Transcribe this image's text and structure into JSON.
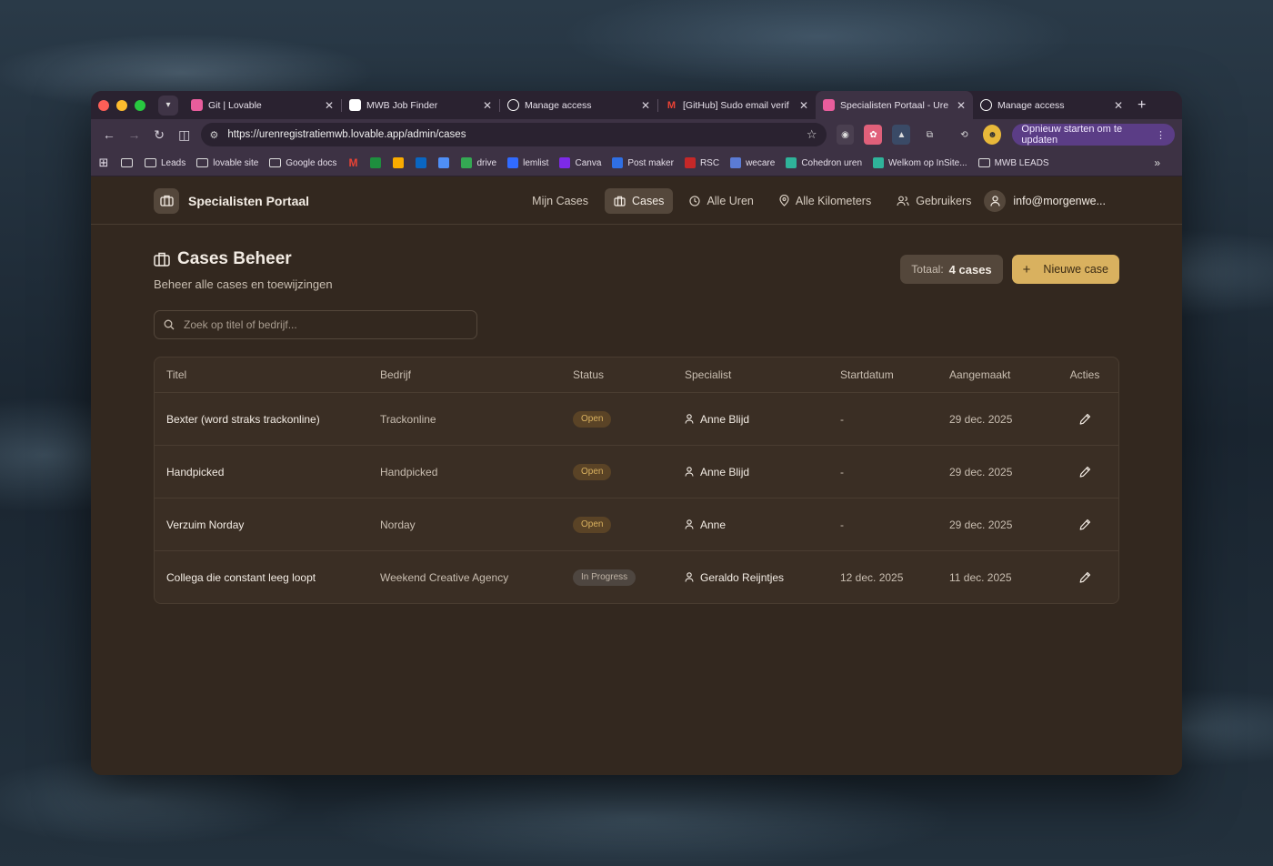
{
  "browser": {
    "tabs": [
      {
        "title": "Git | Lovable",
        "favicon": "lovable-icon",
        "color": "#e85d9c",
        "active": false
      },
      {
        "title": "MWB Job Finder",
        "favicon": "mwb-icon",
        "color": "#ffffff",
        "active": false
      },
      {
        "title": "Manage access",
        "favicon": "github-icon",
        "color": "#ffffff",
        "active": false
      },
      {
        "title": "[GitHub] Sudo email verif",
        "favicon": "gmail-icon",
        "color": "#ea4335",
        "active": false
      },
      {
        "title": "Specialisten Portaal - Ure",
        "favicon": "lovable-icon",
        "color": "#e85d9c",
        "active": true
      },
      {
        "title": "Manage access",
        "favicon": "github-icon",
        "color": "#ffffff",
        "active": false
      }
    ],
    "url": "https://urenregistratiemwb.lovable.app/admin/cases",
    "update_button": "Opnieuw starten om te updaten",
    "bookmarks": [
      {
        "label": "",
        "icon": "apps-icon"
      },
      {
        "label": "",
        "icon": "folder-icon"
      },
      {
        "label": "Leads",
        "icon": "folder-icon"
      },
      {
        "label": "lovable site",
        "icon": "folder-icon"
      },
      {
        "label": "Google docs",
        "icon": "folder-icon"
      },
      {
        "label": "",
        "icon": "gmail-icon",
        "color": "#ea4335"
      },
      {
        "label": "",
        "icon": "meet-icon",
        "color": "#1e8e3e"
      },
      {
        "label": "",
        "icon": "video-icon",
        "color": "#f9ab00"
      },
      {
        "label": "",
        "icon": "linkedin-icon",
        "color": "#0a66c2"
      },
      {
        "label": "",
        "icon": "mail-icon",
        "color": "#4f8ff7"
      },
      {
        "label": "drive",
        "icon": "drive-icon",
        "color": "#34a853"
      },
      {
        "label": "lemlist",
        "icon": "lemlist-icon",
        "color": "#316bff"
      },
      {
        "label": "Canva",
        "icon": "canva-icon",
        "color": "#7d2ae8"
      },
      {
        "label": "Post maker",
        "icon": "postmaker-icon",
        "color": "#2f6fe4"
      },
      {
        "label": "RSC",
        "icon": "rsc-icon",
        "color": "#c62828"
      },
      {
        "label": "wecare",
        "icon": "wecare-icon",
        "color": "#5b7bd5"
      },
      {
        "label": "Cohedron uren",
        "icon": "cohedron-icon",
        "color": "#2fb39a"
      },
      {
        "label": "Welkom op InSite...",
        "icon": "insite-icon",
        "color": "#2fb39a"
      },
      {
        "label": "MWB LEADS",
        "icon": "folder-icon"
      }
    ]
  },
  "app": {
    "brand": "Specialisten Portaal",
    "nav": [
      {
        "label": "Mijn Cases",
        "icon": "",
        "active": false
      },
      {
        "label": "Cases",
        "icon": "briefcase-icon",
        "active": true
      },
      {
        "label": "Alle Uren",
        "icon": "clock-icon",
        "active": false
      },
      {
        "label": "Alle Kilometers",
        "icon": "map-pin-icon",
        "active": false
      },
      {
        "label": "Gebruikers",
        "icon": "users-icon",
        "active": false
      }
    ],
    "user": "info@morgenwe..."
  },
  "page": {
    "title": "Cases Beheer",
    "subtitle": "Beheer alle cases en toewijzingen",
    "total_label": "Totaal:",
    "total_value": "4 cases",
    "new_case_label": "Nieuwe case",
    "search_placeholder": "Zoek op titel of bedrijf..."
  },
  "table": {
    "headers": [
      "Titel",
      "Bedrijf",
      "Status",
      "Specialist",
      "Startdatum",
      "Aangemaakt",
      "Acties"
    ],
    "rows": [
      {
        "titel": "Bexter (word straks trackonline)",
        "bedrijf": "Trackonline",
        "status": "Open",
        "specialist": "Anne Blijd",
        "startdatum": "-",
        "aangemaakt": "29 dec. 2025"
      },
      {
        "titel": "Handpicked",
        "bedrijf": "Handpicked",
        "status": "Open",
        "specialist": "Anne Blijd",
        "startdatum": "-",
        "aangemaakt": "29 dec. 2025"
      },
      {
        "titel": "Verzuim Norday",
        "bedrijf": "Norday",
        "status": "Open",
        "specialist": "Anne",
        "startdatum": "-",
        "aangemaakt": "29 dec. 2025"
      },
      {
        "titel": "Collega die constant leeg loopt",
        "bedrijf": "Weekend Creative Agency",
        "status": "In Progress",
        "specialist": "Geraldo Reijntjes",
        "startdatum": "12 dec. 2025",
        "aangemaakt": "11 dec. 2025"
      }
    ]
  }
}
